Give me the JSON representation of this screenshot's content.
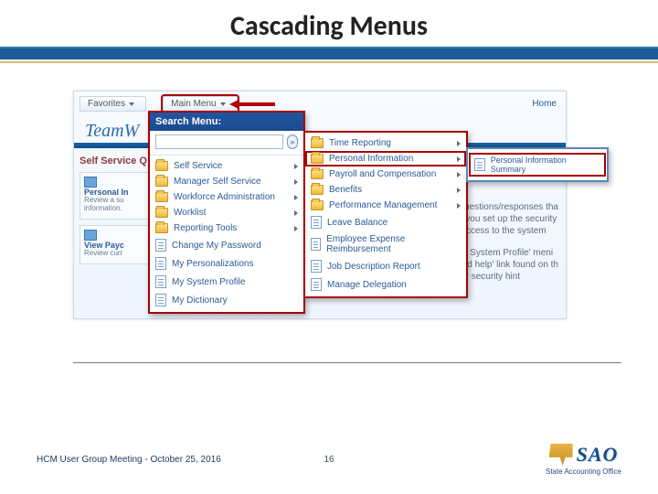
{
  "slide": {
    "title": "Cascading Menus",
    "footer_text": "HCM User Group Meeting - October 25, 2016",
    "page_number": "16",
    "logo_text": "SAO",
    "logo_sub": "State Accounting Office"
  },
  "nav": {
    "favorites": "Favorites",
    "main": "Main Menu",
    "home": "Home",
    "logo": "TeamW"
  },
  "section": {
    "title": "Self Service Q",
    "card1_title": "Personal In",
    "card1_line1": "Review a su",
    "card1_line2": "information.",
    "card2_title": "View Payc",
    "card2_line1": "Review curr"
  },
  "bg": {
    "line1": "ty hint questions/responses tha",
    "line2": "ant that you set up the security",
    "line3": "rupted access to the system",
    "line4": "the 'My System Profile' meni",
    "line5": "assword help' link found on th",
    "line6": "up your security hint"
  },
  "search": {
    "header": "Search Menu:",
    "placeholder": "",
    "go": "»"
  },
  "menu1": {
    "i0": "Self Service",
    "i1": "Manager Self Service",
    "i2": "Workforce Administration",
    "i3": "Worklist",
    "i4": "Reporting Tools",
    "i5": "Change My Password",
    "i6": "My Personalizations",
    "i7": "My System Profile",
    "i8": "My Dictionary"
  },
  "menu2": {
    "i0": "Time Reporting",
    "i1": "Personal Information",
    "i2": "Payroll and Compensation",
    "i3": "Benefits",
    "i4": "Performance Management",
    "i5": "Leave Balance",
    "i6": "Employee Expense Reimbursement",
    "i7": "Job Description Report",
    "i8": "Manage Delegation"
  },
  "menu3": {
    "i0": "Personal Information Summary"
  }
}
